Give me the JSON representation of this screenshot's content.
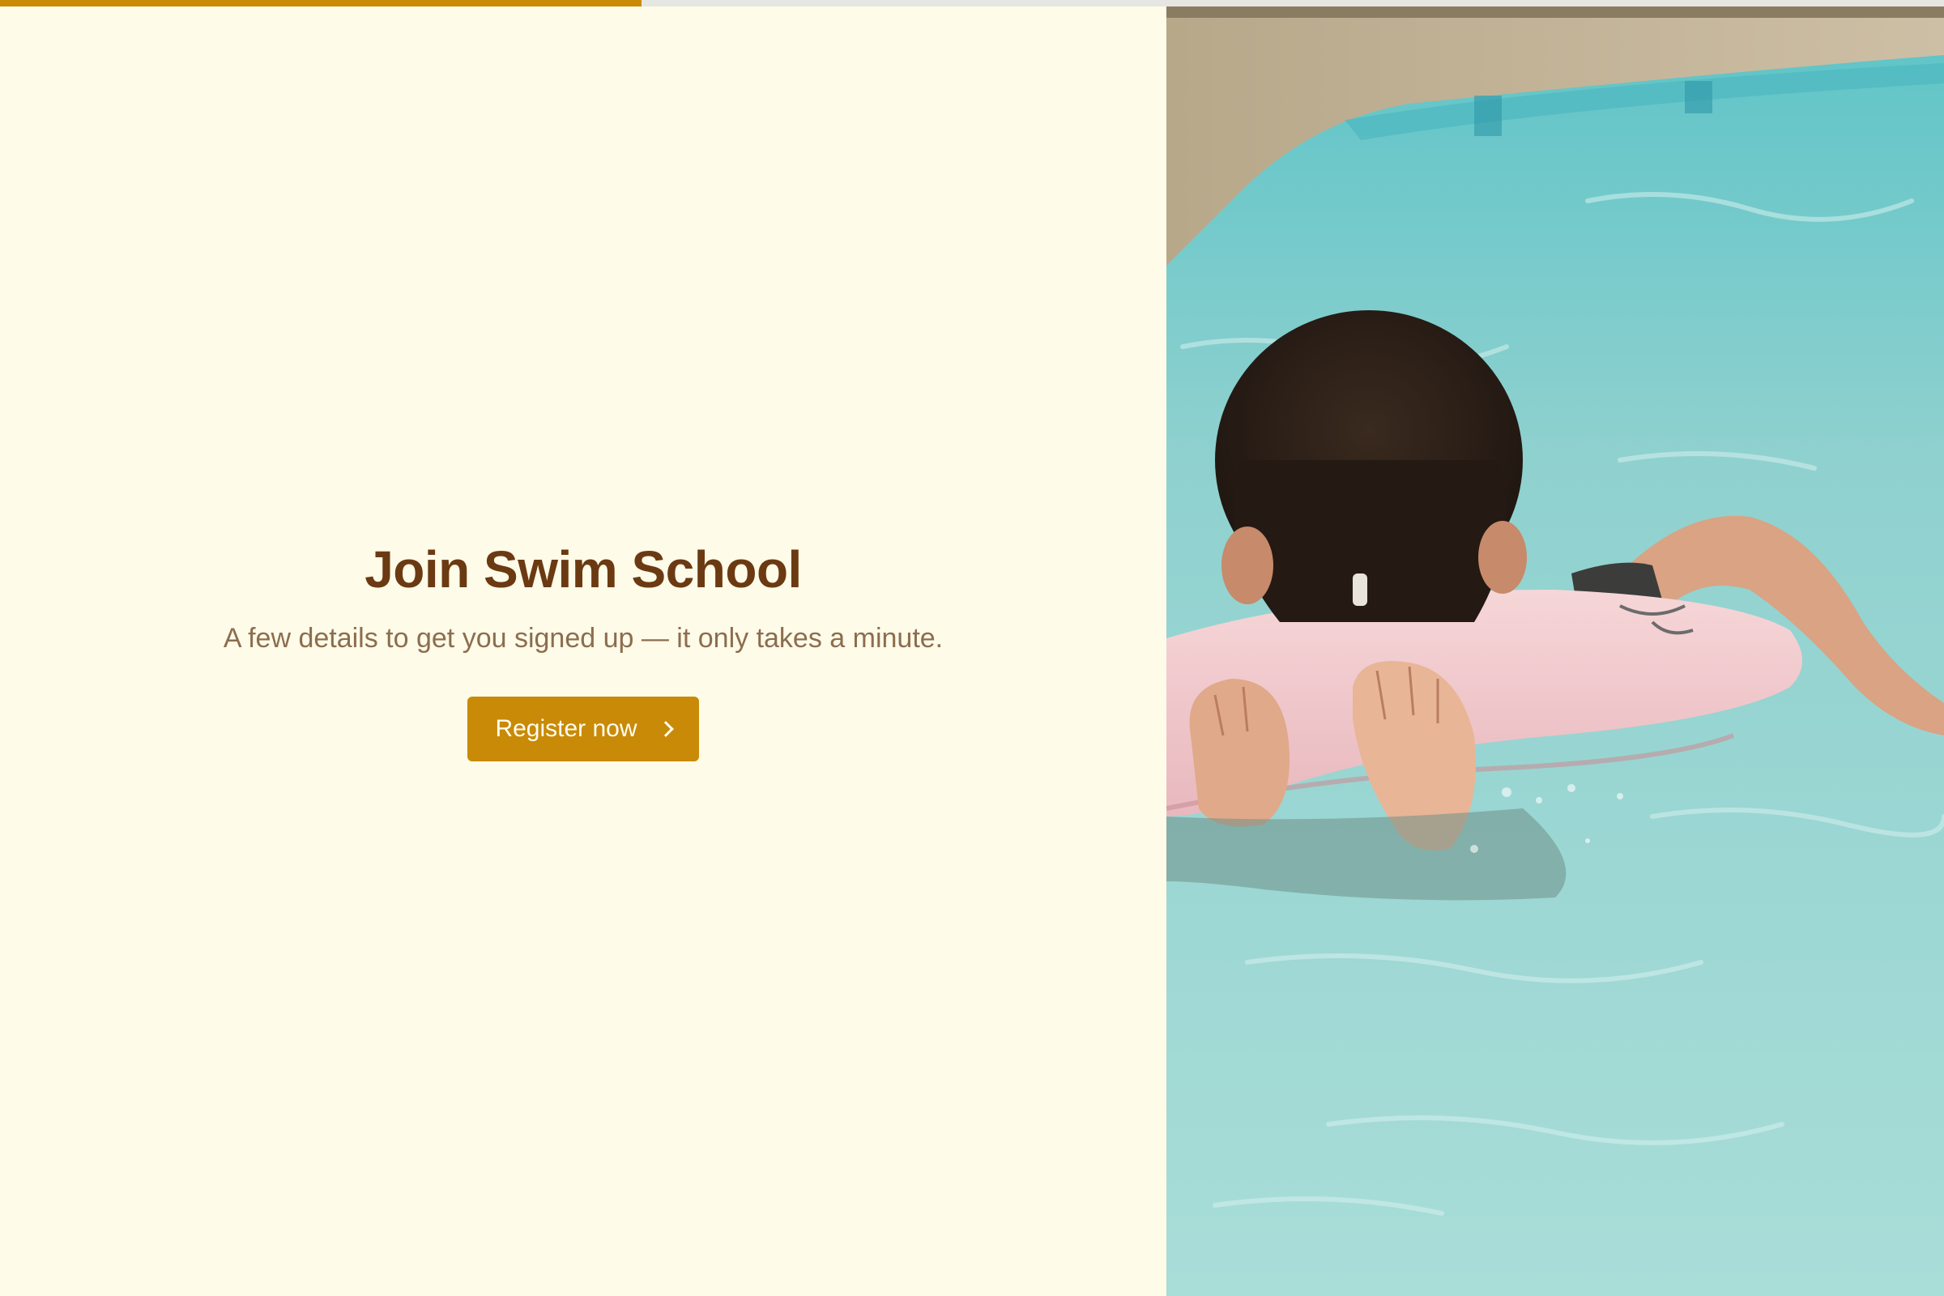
{
  "progress": {
    "value_percent": 33
  },
  "hero": {
    "title": "Join Swim School",
    "subtitle": "A few details to get you signed up — it only takes a minute.",
    "cta_label": "Register now",
    "cta_icon": "chevron-right-icon"
  },
  "photo": {
    "subject": "child-swimming-with-pink-float"
  },
  "colors": {
    "accent": "#c98a07",
    "title": "#6b3a12",
    "subtitle": "#8c6d4f",
    "background": "#fefbe8"
  }
}
